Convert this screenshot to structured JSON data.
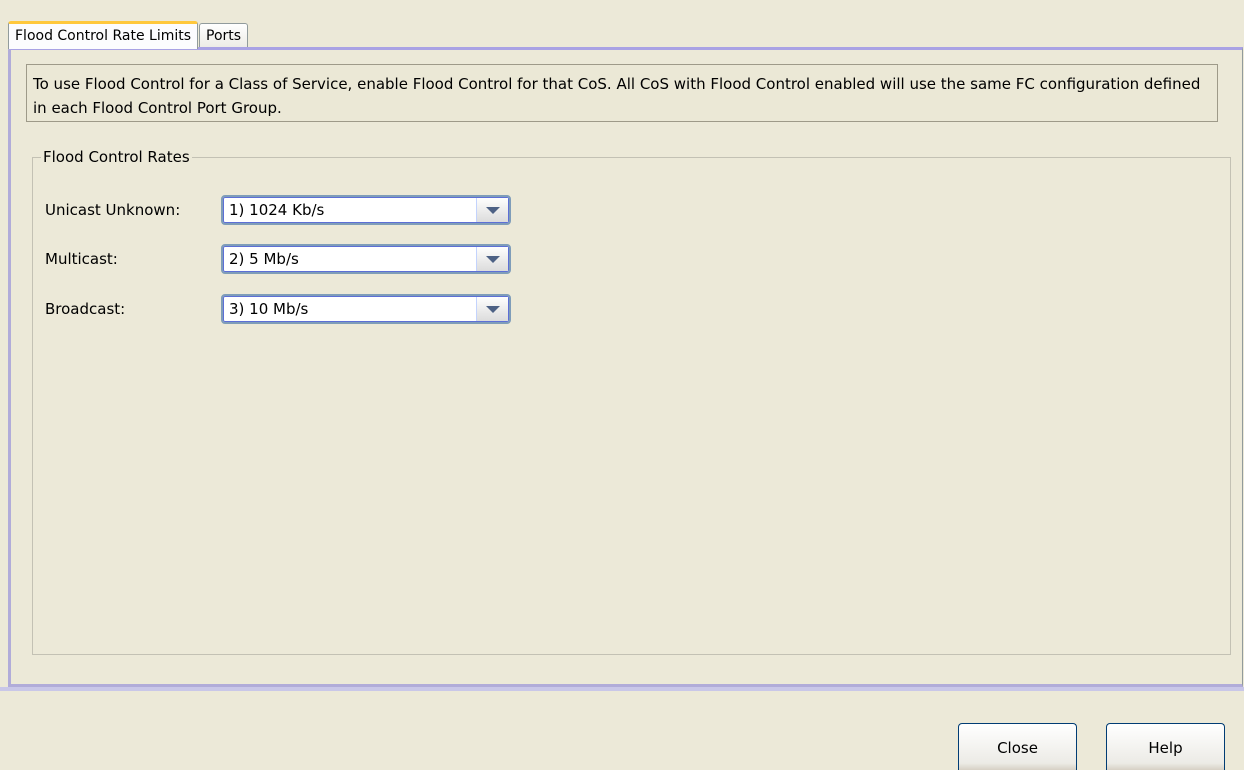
{
  "tabs": [
    {
      "label": "Flood Control Rate Limits",
      "active": true
    },
    {
      "label": "Ports",
      "active": false
    }
  ],
  "info": {
    "text": "To use Flood Control for a Class of Service, enable Flood Control for that CoS. All CoS with Flood Control enabled will use the same FC configuration defined in each Flood Control Port Group."
  },
  "rates_group": {
    "title": "Flood Control Rates",
    "rows": [
      {
        "label": "Unicast Unknown:",
        "value": "1) 1024 Kb/s"
      },
      {
        "label": "Multicast:",
        "value": "2) 5 Mb/s"
      },
      {
        "label": "Broadcast:",
        "value": "3) 10 Mb/s"
      }
    ]
  },
  "buttons": {
    "close": "Close",
    "help": "Help"
  },
  "colors": {
    "background": "#ece9d8",
    "active_tab_highlight": "#ffc83c",
    "panel_border": "#b1acd9",
    "combo_border": "#7f9db9"
  }
}
